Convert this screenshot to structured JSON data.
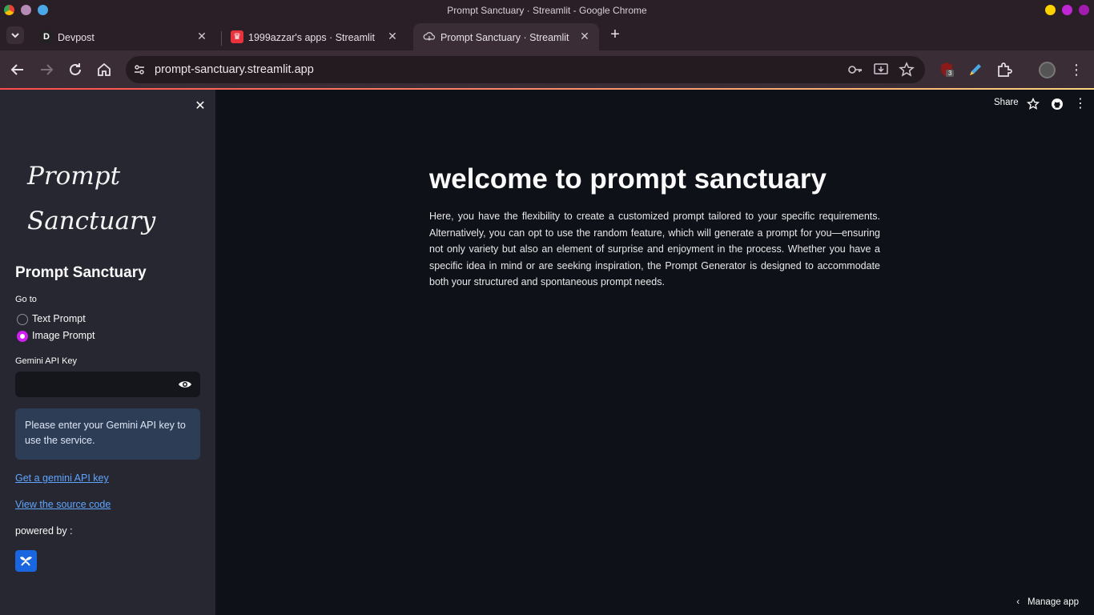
{
  "window": {
    "title": "Prompt Sanctuary · Streamlit - Google Chrome",
    "dot_colors": [
      "#fbd100",
      "#c026d3",
      "#a21caf"
    ]
  },
  "tabs": [
    {
      "label": "Devpost",
      "favicon": "D",
      "active": false
    },
    {
      "label": "1999azzar's apps · Streamlit",
      "favicon": "crown",
      "active": false
    },
    {
      "label": "Prompt Sanctuary · Streamlit",
      "favicon": "cloud",
      "active": true
    }
  ],
  "toolbar": {
    "url": "prompt-sanctuary.streamlit.app",
    "extension_badge": "3"
  },
  "sidebar": {
    "logo_line1": "Prompt",
    "logo_line2": "Sanctuary",
    "title": "Prompt Sanctuary",
    "goto_label": "Go to",
    "radio_options": [
      {
        "label": "Text Prompt",
        "selected": false
      },
      {
        "label": "Image Prompt",
        "selected": true
      }
    ],
    "api_key_label": "Gemini API Key",
    "api_key_value": "",
    "info_message": "Please enter your Gemini API key to use the service.",
    "link_api_key": "Get a gemini API key",
    "link_source": "View the source code",
    "powered_by": "powered by :"
  },
  "main": {
    "share_label": "Share",
    "heading": "welcome to prompt sanctuary",
    "paragraph": "Here, you have the flexibility to create a customized prompt tailored to your specific requirements. Alternatively, you can opt to use the random feature, which will generate a prompt for you—ensuring not only variety but also an element of surprise and enjoyment in the process. Whether you have a specific idea in mind or are seeking inspiration, the Prompt Generator is designed to accommodate both your structured and spontaneous prompt needs.",
    "manage_app": "Manage app"
  },
  "colors": {
    "accent_radio": "#d21df2",
    "info_bg": "#2e3d56",
    "link": "#60a5ff",
    "sidebar_bg": "#262730",
    "main_bg": "#0e1117"
  }
}
